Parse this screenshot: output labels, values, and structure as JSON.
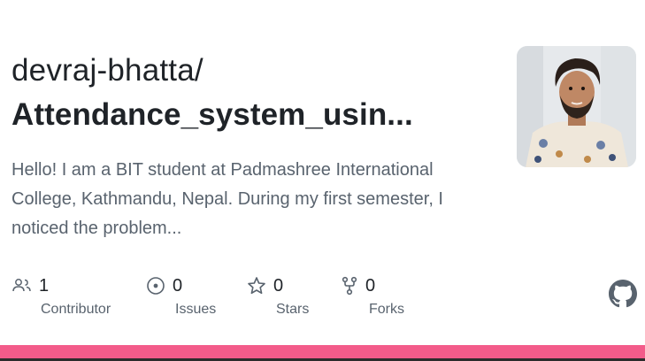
{
  "repo": {
    "owner": "devraj-bhatta/",
    "name": "Attendance_system_usin...",
    "description": "Hello! I am a BIT student at Padmashree International College, Kathmandu, Nepal. During my first semester, I noticed the problem..."
  },
  "stats": [
    {
      "icon": "people-icon",
      "value": "1",
      "label": "Contributor"
    },
    {
      "icon": "issue-icon",
      "value": "0",
      "label": "Issues"
    },
    {
      "icon": "star-icon",
      "value": "0",
      "label": "Stars"
    },
    {
      "icon": "fork-icon",
      "value": "0",
      "label": "Forks"
    }
  ],
  "logo": "github-icon",
  "colors": {
    "accent_bar": "#f35b8a",
    "text": "#1f2328",
    "muted": "#59636e"
  }
}
